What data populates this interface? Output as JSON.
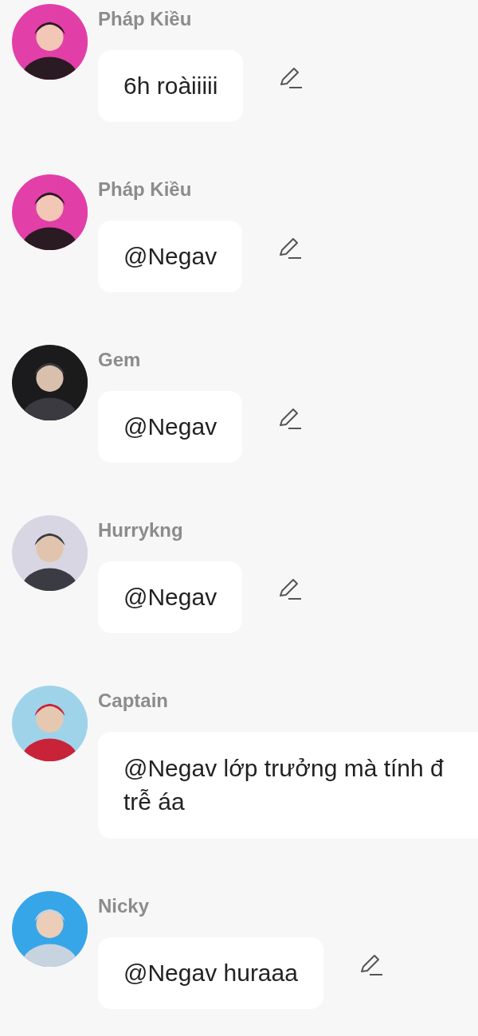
{
  "messages": [
    {
      "sender": "Pháp Kiều",
      "text": "6h roàiiiii",
      "edit_icon": true
    },
    {
      "sender": "Pháp Kiều",
      "text": "@Negav",
      "edit_icon": true
    },
    {
      "sender": "Gem",
      "text": "@Negav",
      "edit_icon": true
    },
    {
      "sender": "Hurrykng",
      "text": "@Negav",
      "edit_icon": true
    },
    {
      "sender": "Captain",
      "text": "@Negav lớp trưởng mà tính đ\ntrễ áa",
      "edit_icon": false
    },
    {
      "sender": "Nicky",
      "text": "@Negav huraaa",
      "edit_icon": true
    }
  ]
}
